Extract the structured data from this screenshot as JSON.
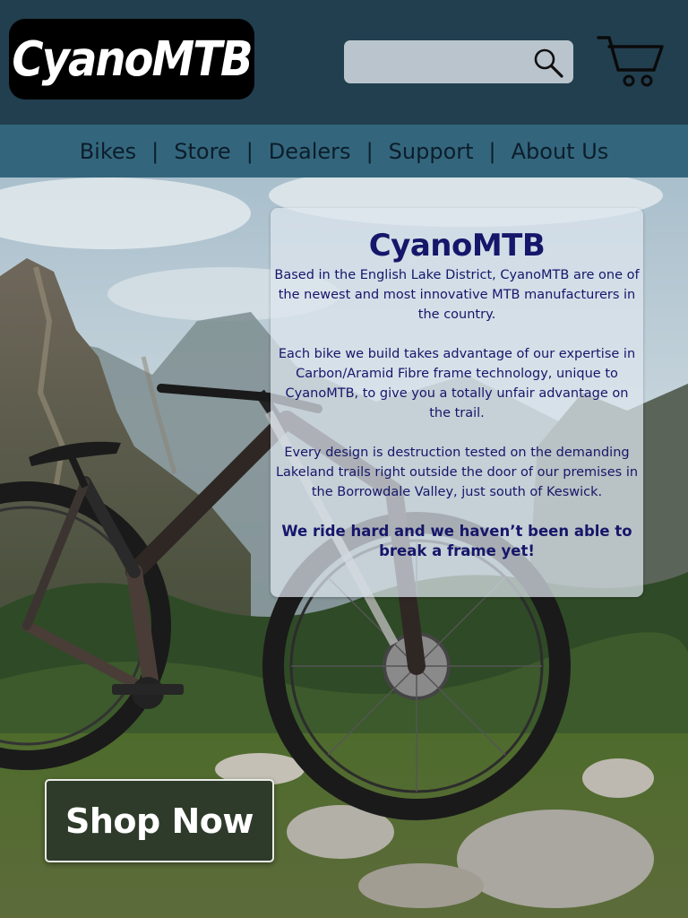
{
  "brand": {
    "logo_text": "CyanoMTB"
  },
  "search": {
    "placeholder": "",
    "value": "",
    "icon": "search-icon"
  },
  "cart": {
    "icon": "cart-icon"
  },
  "nav": {
    "items": [
      {
        "label": "Bikes"
      },
      {
        "label": "Store"
      },
      {
        "label": "Dealers"
      },
      {
        "label": "Support"
      },
      {
        "label": "About Us"
      }
    ],
    "separator": "|"
  },
  "info": {
    "title": "CyanoMTB",
    "paragraphs": [
      "Based in the English Lake District, CyanoMTB are one of the newest and most innovative MTB manufacturers in the country.",
      "Each bike we build takes advantage of our expertise in Carbon/Aramid Fibre frame technology, unique to CyanoMTB, to give you a totally unfair advantage on the trail.",
      "Every design is destruction tested on the demanding Lakeland trails right outside the door of our premises in the Borrowdale Valley, just south of Keswick.",
      "We ride hard and we haven’t been able to break a frame yet!"
    ]
  },
  "cta": {
    "label": "Shop Now"
  },
  "colors": {
    "header_bg": "#223f4f",
    "nav_bg": "#33667c",
    "nav_text": "#0c1d2b",
    "card_text": "#16166a",
    "button_bg": "#2e3b2b"
  }
}
